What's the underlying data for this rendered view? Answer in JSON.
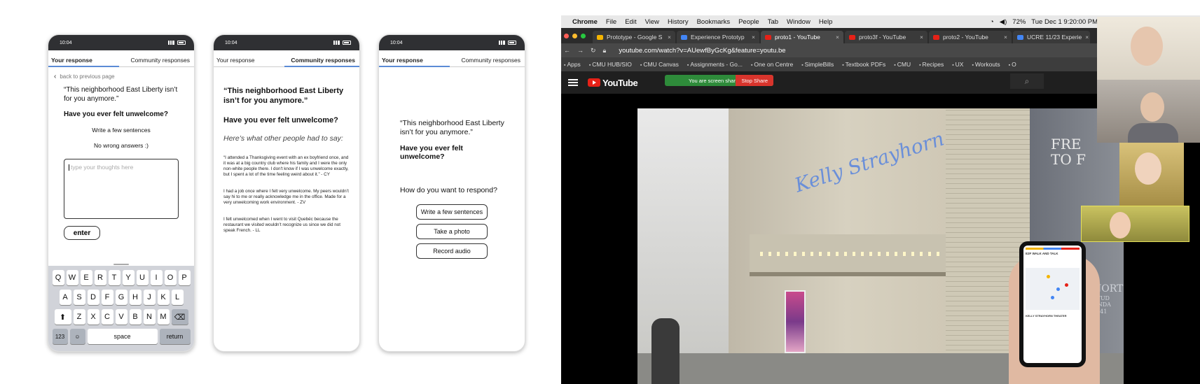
{
  "phone_status": {
    "time": "10:04"
  },
  "phone1": {
    "tabs": [
      "Your response",
      "Community responses"
    ],
    "back": "back to previous page",
    "quote": "“This neighborhood East Liberty isn’t for you anymore.”",
    "question": "Have you ever felt unwelcome?",
    "hint1": "Write a few sentences",
    "hint2": "No wrong answers :)",
    "placeholder": "type your thoughts here",
    "enter": "enter",
    "keyboard": {
      "row1": [
        "Q",
        "W",
        "E",
        "R",
        "T",
        "Y",
        "U",
        "I",
        "O",
        "P"
      ],
      "row2": [
        "A",
        "S",
        "D",
        "F",
        "G",
        "H",
        "J",
        "K",
        "L"
      ],
      "row3": [
        "Z",
        "X",
        "C",
        "V",
        "B",
        "N",
        "M"
      ],
      "num": "123",
      "space": "space",
      "return": "return"
    }
  },
  "phone2": {
    "tabs": [
      "Your response",
      "Community responses"
    ],
    "quote": "“This neighborhood East Liberty isn’t for you anymore.”",
    "question": "Have you ever felt unwelcome?",
    "intro": "Here’s what other people had to say:",
    "comments": [
      "“I attended a Thanksgiving event with an ex boyfriend once, and it was at a big country club where his family and I were the only non-white people there. I don't know if I was unwelcome exactly, but I spent a lot of the time feeling weird about it.” - CY",
      "I had a job once where I felt very unwelcome. My peers wouldn’t say hi to me or really acknowledge me in the office. Made for a very unwelcoming work environment. - ZV",
      "I felt unwelcomed when I went to visit Quebéc because the restaurant we visited wouldn’t recognize us since we did not speak French. - LL"
    ]
  },
  "phone3": {
    "tabs": [
      "Your response",
      "Community responses"
    ],
    "quote": "“This neighborhood East Liberty isn’t for you anymore.”",
    "question": "Have you ever felt unwelcome?",
    "prompt": "How do you want to respond?",
    "buttons": [
      "Write a few sentences",
      "Take a photo",
      "Record audio"
    ]
  },
  "mac_menu": {
    "items": [
      "Chrome",
      "File",
      "Edit",
      "View",
      "History",
      "Bookmarks",
      "People",
      "Tab",
      "Window",
      "Help"
    ],
    "battery": "72%",
    "clock": "Tue Dec 1  9:20:00 PM"
  },
  "browser": {
    "tabs": [
      {
        "title": "Prototype - Google S",
        "color": "#f4b400"
      },
      {
        "title": "Experience Prototyp",
        "color": "#4285f4"
      },
      {
        "title": "proto1 - YouTube",
        "color": "#e62117"
      },
      {
        "title": "proto3f - YouTube",
        "color": "#e62117"
      },
      {
        "title": "proto2 - YouTube",
        "color": "#e62117"
      },
      {
        "title": "UCRE 11/23 Experie",
        "color": "#4285f4"
      }
    ],
    "url": "youtube.com/watch?v=AUewfByGcKg&feature=youtu.be",
    "bookmarks": [
      "Apps",
      "CMU HUB/SIO",
      "CMU Canvas",
      "Assignments - Go...",
      "One on Centre",
      "SimpleBills",
      "Textbook PDFs",
      "CMU",
      "Recipes",
      "UX",
      "Workouts",
      "O"
    ]
  },
  "youtube": {
    "logo": "YouTube",
    "sharing": "You are screen sharing",
    "stop": "Stop Share"
  },
  "video_scene": {
    "sign_left": "FRE",
    "sign_left2": "TO F",
    "sign_right": "NORT",
    "sign_right2": "STUD",
    "sign_right3": "UNDA",
    "sign_right4": "9941",
    "phone_title": "E2F WALK AND TALK",
    "phone_caption": "KELLY STRAYHORN THEATER"
  },
  "colors": {
    "tab_underline": "#5b8bd6",
    "share_green": "#2e8b3a",
    "stop_red": "#d8342c",
    "yt_red": "#e62117"
  }
}
